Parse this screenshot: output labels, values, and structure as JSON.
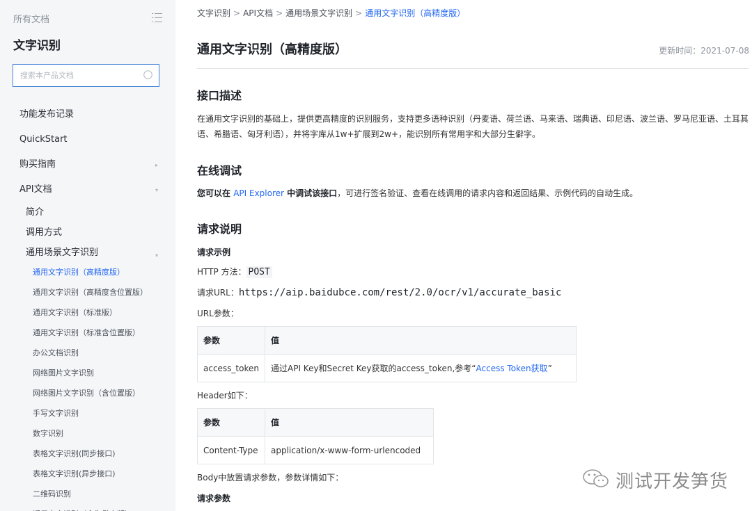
{
  "sidebar": {
    "all_docs": "所有文档",
    "product_title": "文字识别",
    "search_placeholder": "搜索本产品文档",
    "nav": [
      {
        "label": "功能发布记录",
        "level": 1
      },
      {
        "label": "QuickStart",
        "level": 1
      },
      {
        "label": "购买指南",
        "level": 1,
        "caret": "▸"
      },
      {
        "label": "API文档",
        "level": 1,
        "caret": "▾"
      },
      {
        "label": "简介",
        "level": 2
      },
      {
        "label": "调用方式",
        "level": 2
      },
      {
        "label": "通用场景文字识别",
        "level": 2,
        "caret": "▾"
      },
      {
        "label": "通用文字识别（高精度版）",
        "level": 3,
        "active": true
      },
      {
        "label": "通用文字识别（高精度含位置版）",
        "level": 3
      },
      {
        "label": "通用文字识别（标准版）",
        "level": 3
      },
      {
        "label": "通用文字识别（标准含位置版）",
        "level": 3
      },
      {
        "label": "办公文档识别",
        "level": 3
      },
      {
        "label": "网络图片文字识别",
        "level": 3
      },
      {
        "label": "网络图片文字识别（含位置版）",
        "level": 3
      },
      {
        "label": "手写文字识别",
        "level": 3
      },
      {
        "label": "数字识别",
        "level": 3
      },
      {
        "label": "表格文字识别(同步接口)",
        "level": 3
      },
      {
        "label": "表格文字识别(异步接口)",
        "level": 3
      },
      {
        "label": "二维码识别",
        "level": 3
      },
      {
        "label": "通用文字识别（含生僻字版）",
        "level": 3
      }
    ]
  },
  "breadcrumb": {
    "items": [
      "文字识别",
      "API文档",
      "通用场景文字识别"
    ],
    "current": "通用文字识别（高精度版）",
    "separator": ">"
  },
  "doc": {
    "title": "通用文字识别（高精度版）",
    "updated": "更新时间：2021-07-08",
    "s1_title": "接口描述",
    "s1_text": "在通用文字识别的基础上，提供更高精度的识别服务，支持更多语种识别（丹麦语、荷兰语、马来语、瑞典语、印尼语、波兰语、罗马尼亚语、土耳其语、希腊语、匈牙利语），并将字库从1w+扩展到2w+，能识别所有常用字和大部分生僻字。",
    "s2_title": "在线调试",
    "s2_prefix": "您可以在 ",
    "s2_link": "API Explorer",
    "s2_mid": " 中调试该接口",
    "s2_suffix": "，可进行签名验证、查看在线调用的请求内容和返回结果、示例代码的自动生成。",
    "s3_title": "请求说明",
    "example_label": "请求示例",
    "http_method_label": "HTTP 方法：",
    "http_method_value": "POST",
    "url_label": "请求URL：",
    "url_value": "https://aip.baidubce.com/rest/2.0/ocr/v1/accurate_basic",
    "url_params_label": "URL参数：",
    "url_table": {
      "h_param": "参数",
      "h_value": "值",
      "param": "access_token",
      "value_prefix": "通过API Key和Secret Key获取的access_token,参考“",
      "value_link": "Access Token获取",
      "value_suffix": "”"
    },
    "header_label": "Header如下：",
    "header_table": {
      "h_param": "参数",
      "h_value": "值",
      "param": "Content-Type",
      "value": "application/x-www-form-urlencoded"
    },
    "body_label": "Body中放置请求参数，参数详情如下：",
    "req_params_label": "请求参数"
  },
  "watermark": {
    "text": "测试开发笋货",
    "icon": "wechat-icon"
  },
  "colors": {
    "accent": "#2468f2",
    "sidebar_bg": "#f5f6f8",
    "search_border": "#3f7fd9"
  }
}
